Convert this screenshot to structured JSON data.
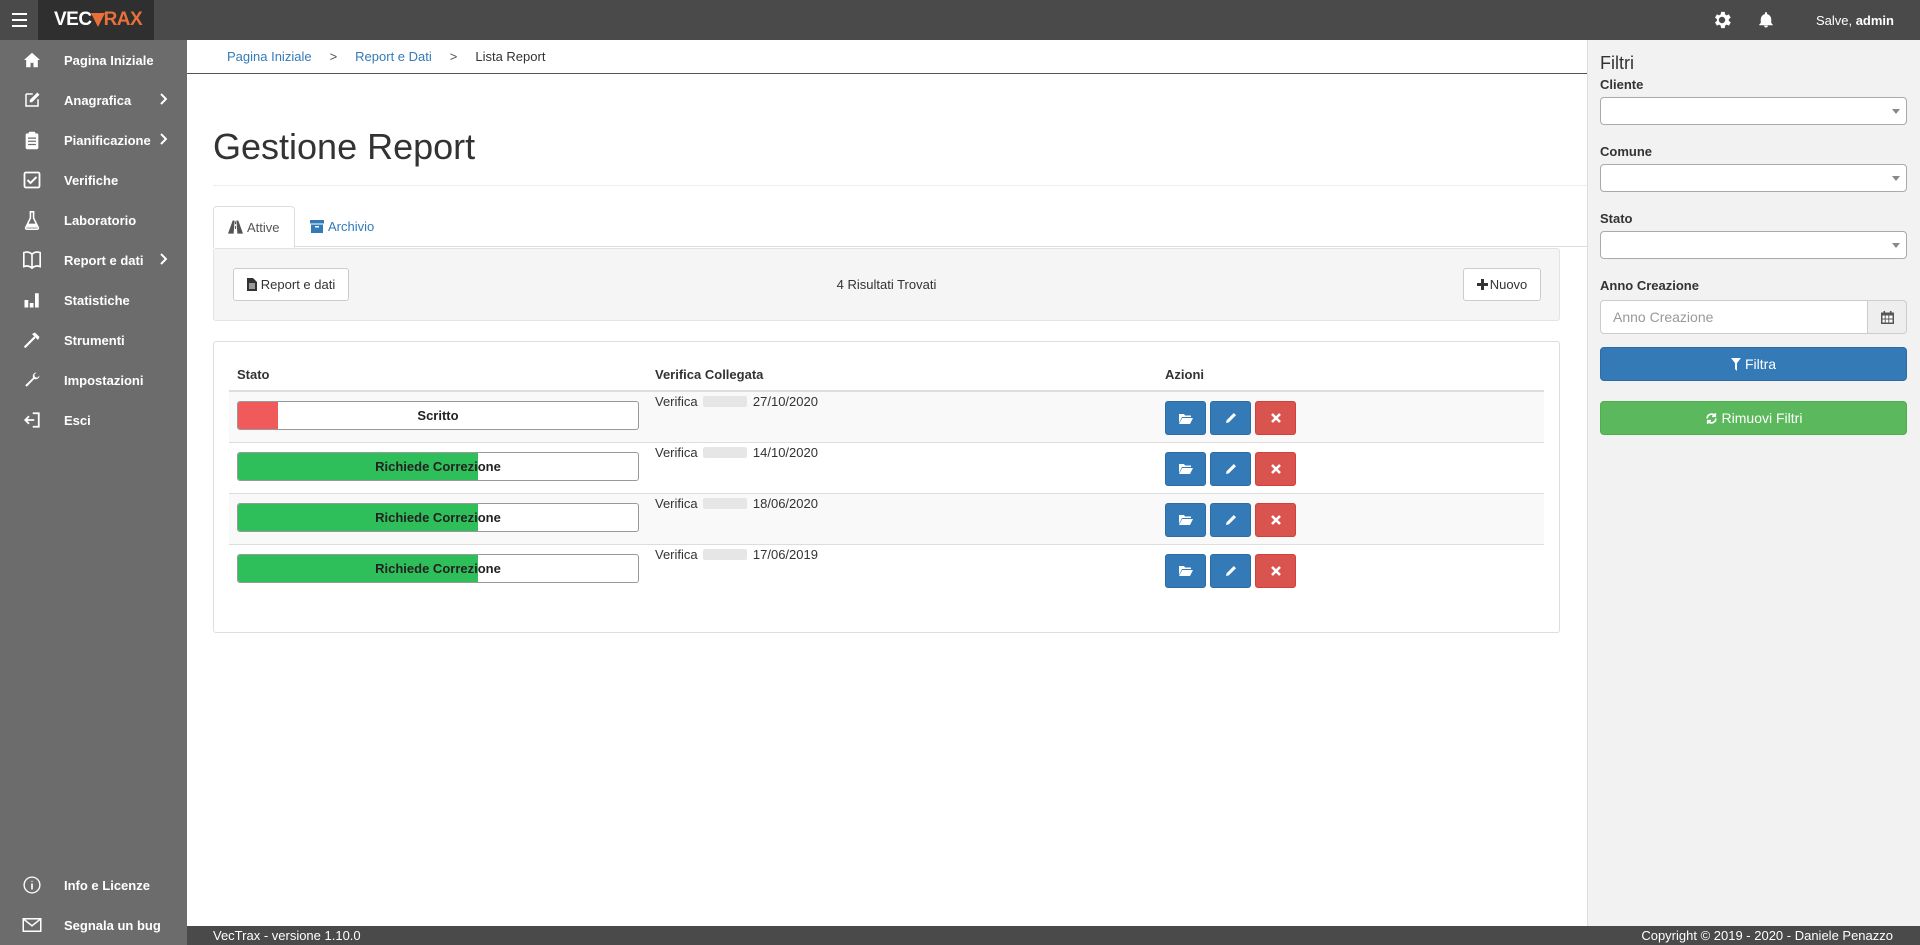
{
  "app": {
    "logo_left": "VEC",
    "logo_right": "RAX"
  },
  "topbar": {
    "greeting_prefix": "Salve,",
    "username": "admin",
    "icons": [
      "settings-icon",
      "bell-icon"
    ]
  },
  "sidebar": {
    "items": [
      {
        "label": "Pagina Iniziale",
        "icon": "home-icon",
        "has_submenu": false
      },
      {
        "label": "Anagrafica",
        "icon": "edit-icon",
        "has_submenu": true
      },
      {
        "label": "Pianificazione",
        "icon": "clipboard-icon",
        "has_submenu": true
      },
      {
        "label": "Verifiche",
        "icon": "checkbox-icon",
        "has_submenu": false
      },
      {
        "label": "Laboratorio",
        "icon": "flask-icon",
        "has_submenu": false
      },
      {
        "label": "Report e dati",
        "icon": "book-icon",
        "has_submenu": true
      },
      {
        "label": "Statistiche",
        "icon": "bar-chart-icon",
        "has_submenu": false
      },
      {
        "label": "Strumenti",
        "icon": "hammer-icon",
        "has_submenu": false
      },
      {
        "label": "Impostazioni",
        "icon": "wrench-icon",
        "has_submenu": false
      },
      {
        "label": "Esci",
        "icon": "logout-icon",
        "has_submenu": false
      }
    ],
    "bottom_items": [
      {
        "label": "Info e Licenze",
        "icon": "info-icon"
      },
      {
        "label": "Segnala un bug",
        "icon": "mail-icon"
      }
    ]
  },
  "breadcrumb": {
    "items": [
      "Pagina Iniziale",
      "Report e Dati"
    ],
    "separator": ">",
    "current": "Lista Report"
  },
  "page": {
    "title": "Gestione Report"
  },
  "tabs": [
    {
      "label": "Attive",
      "icon": "road-icon",
      "active": true
    },
    {
      "label": "Archivio",
      "icon": "archive-icon",
      "active": false
    }
  ],
  "toolbar": {
    "report_button": "Report e dati",
    "results_text": "4 Risultati Trovati",
    "new_button": "Nuovo"
  },
  "table": {
    "headers": [
      "Stato",
      "Verifica Collegata",
      "Azioni"
    ],
    "rows": [
      {
        "status": "Scritto",
        "progress": 0.1,
        "color": "#f05a5a",
        "verifica_prefix": "Verifica",
        "verifica_date": "27/10/2020"
      },
      {
        "status": "Richiede Correzione",
        "progress": 0.6,
        "color": "#2fbf5a",
        "verifica_prefix": "Verifica",
        "verifica_date": "14/10/2020"
      },
      {
        "status": "Richiede Correzione",
        "progress": 0.6,
        "color": "#2fbf5a",
        "verifica_prefix": "Verifica",
        "verifica_date": "18/06/2020"
      },
      {
        "status": "Richiede Correzione",
        "progress": 0.6,
        "color": "#2fbf5a",
        "verifica_prefix": "Verifica",
        "verifica_date": "17/06/2019"
      }
    ],
    "action_icons": [
      "folder-open-icon",
      "pencil-icon",
      "close-icon"
    ]
  },
  "filters": {
    "title": "Filtri",
    "cliente_label": "Cliente",
    "comune_label": "Comune",
    "stato_label": "Stato",
    "anno_label": "Anno Creazione",
    "anno_placeholder": "Anno Creazione",
    "filter_button": "Filtra",
    "reset_button": "Rimuovi Filtri"
  },
  "footer": {
    "version": "VecTrax - versione 1.10.0",
    "copyright": "Copyright © 2019 - 2020 - Daniele Penazzo"
  },
  "colors": {
    "topbar": "#4a4a4a",
    "sidebar": "#6c6c6c",
    "primary": "#337ab7",
    "danger": "#d9534f",
    "success": "#5cb85c",
    "brand_orange": "#e8703a"
  }
}
